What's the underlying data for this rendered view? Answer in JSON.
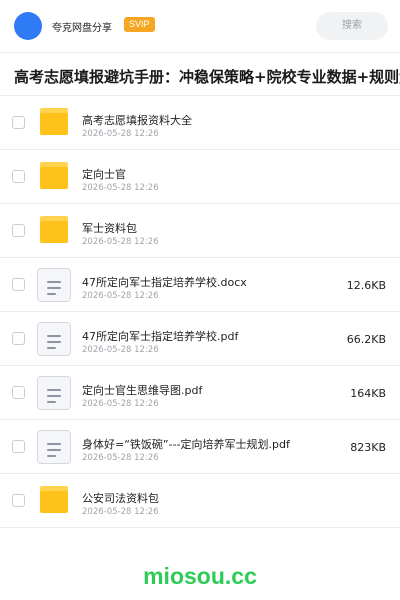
{
  "header": {
    "username": "夸克网盘分享",
    "badge": "SVIP",
    "search_placeholder": "搜索",
    "colors": {
      "avatar": "#2f7bf5",
      "badge": "#f5a623"
    }
  },
  "share_title": "高考志愿填报避坑手册：冲稳保策略+院校专业数据+规则解读",
  "files": [
    {
      "type": "folder",
      "name": "高考志愿填报资料大全",
      "date": "2026-05-28 12:26",
      "size": ""
    },
    {
      "type": "folder",
      "name": "定向士官",
      "date": "2026-05-28 12:26",
      "size": ""
    },
    {
      "type": "folder",
      "name": "军士资料包",
      "date": "2026-05-28 12:26",
      "size": ""
    },
    {
      "type": "doc",
      "name": "47所定向军士指定培养学校.docx",
      "date": "2026-05-28 12:26",
      "size": "12.6KB"
    },
    {
      "type": "doc",
      "name": "47所定向军士指定培养学校.pdf",
      "date": "2026-05-28 12:26",
      "size": "66.2KB"
    },
    {
      "type": "doc",
      "name": "定向士官生思维导图.pdf",
      "date": "2026-05-28 12:26",
      "size": "164KB"
    },
    {
      "type": "doc",
      "name": "身体好=“铁饭碗”---定向培养军士规划.pdf",
      "date": "2026-05-28 12:26",
      "size": "823KB"
    },
    {
      "type": "folder",
      "name": "公安司法资料包",
      "date": "2026-05-28 12:26",
      "size": ""
    }
  ],
  "footer": {
    "brand": "miosou.cc",
    "brand_color": "#2ecc55"
  }
}
